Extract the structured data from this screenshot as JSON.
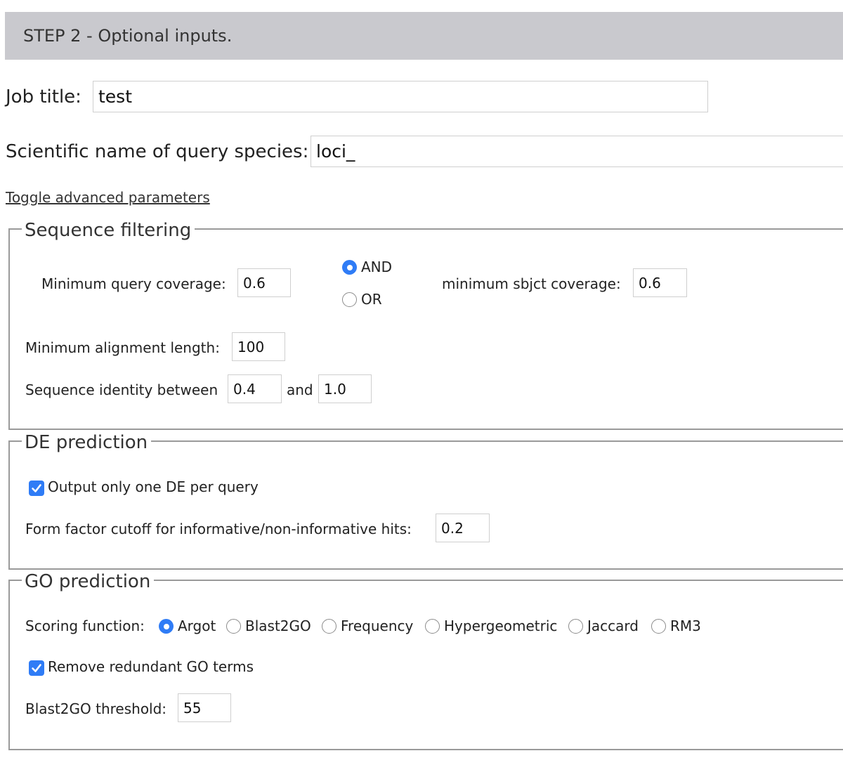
{
  "header": {
    "title": "STEP 2 - Optional inputs."
  },
  "job_title": {
    "label": "Job title:",
    "value": "test"
  },
  "species": {
    "label": "Scientific name of query species:",
    "value": "loci_"
  },
  "toggle_advanced": {
    "label": "Toggle advanced parameters"
  },
  "sequence_filtering": {
    "legend": "Sequence filtering",
    "min_query_coverage": {
      "label": "Minimum query coverage:",
      "value": "0.6"
    },
    "logic": {
      "options": [
        "AND",
        "OR"
      ],
      "selected": "AND"
    },
    "min_sbjct_coverage": {
      "label": "minimum sbjct coverage:",
      "value": "0.6"
    },
    "min_alignment_length": {
      "label": "Minimum alignment length:",
      "value": "100"
    },
    "identity": {
      "label": "Sequence identity between",
      "min": "0.4",
      "and_label": "and",
      "max": "1.0"
    }
  },
  "de_prediction": {
    "legend": "DE prediction",
    "one_de": {
      "label": "Output only one DE per query",
      "checked": true
    },
    "form_factor": {
      "label": "Form factor cutoff for informative/non-informative hits:",
      "value": "0.2"
    }
  },
  "go_prediction": {
    "legend": "GO prediction",
    "scoring": {
      "label": "Scoring function:",
      "options": [
        "Argot",
        "Blast2GO",
        "Frequency",
        "Hypergeometric",
        "Jaccard",
        "RM3"
      ],
      "selected": "Argot"
    },
    "remove_redundant": {
      "label": "Remove redundant GO terms",
      "checked": true
    },
    "blast2go_threshold": {
      "label": "Blast2GO threshold:",
      "value": "55"
    }
  },
  "colors": {
    "accent": "#2f7cf6",
    "header_bg": "#c9c9ce",
    "fieldset_border": "#9a9a9a"
  }
}
